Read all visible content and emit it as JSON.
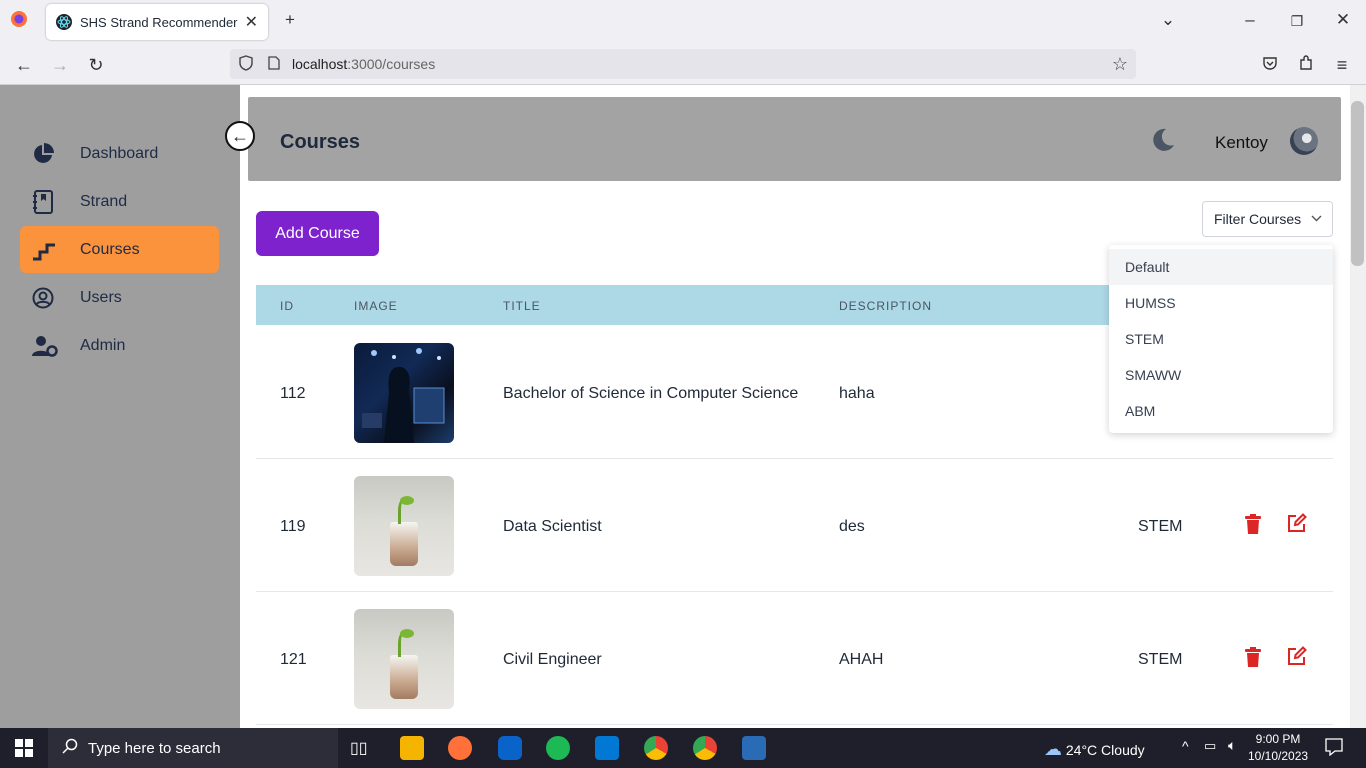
{
  "browser": {
    "tab_title": "SHS Strand Recommender",
    "url_host": "localhost",
    "url_path": ":3000/courses"
  },
  "sidebar": {
    "items": [
      {
        "label": "Dashboard",
        "icon": "pie-chart-icon"
      },
      {
        "label": "Strand",
        "icon": "book-icon"
      },
      {
        "label": "Courses",
        "icon": "stairs-icon",
        "active": true
      },
      {
        "label": "Users",
        "icon": "user-circle-icon"
      },
      {
        "label": "Admin",
        "icon": "user-gear-icon"
      }
    ]
  },
  "header": {
    "title": "Courses",
    "username": "Kentoy"
  },
  "toolbar": {
    "add_label": "Add Course",
    "filter_label": "Filter Courses"
  },
  "filter_menu": {
    "options": [
      "Default",
      "HUMSS",
      "STEM",
      "SMAWW",
      "ABM"
    ],
    "selected": "Default"
  },
  "table": {
    "columns": [
      "ID",
      "IMAGE",
      "TITLE",
      "DESCRIPTION"
    ],
    "rows": [
      {
        "id": "112",
        "title": "Bachelor of Science in Computer Science",
        "description": "haha",
        "strand": ""
      },
      {
        "id": "119",
        "title": "Data Scientist",
        "description": "des",
        "strand": "STEM"
      },
      {
        "id": "121",
        "title": "Civil Engineer",
        "description": "AHAH",
        "strand": "STEM"
      }
    ]
  },
  "colors": {
    "sidebar_bg": "#9e9e9e",
    "active_item": "#fb923c",
    "add_button": "#7e22ce",
    "table_head": "#add8e6",
    "delete_icon": "#dc2626"
  },
  "taskbar": {
    "search_placeholder": "Type here to search",
    "weather": "24°C  Cloudy",
    "time": "9:00 PM",
    "date": "10/10/2023"
  }
}
